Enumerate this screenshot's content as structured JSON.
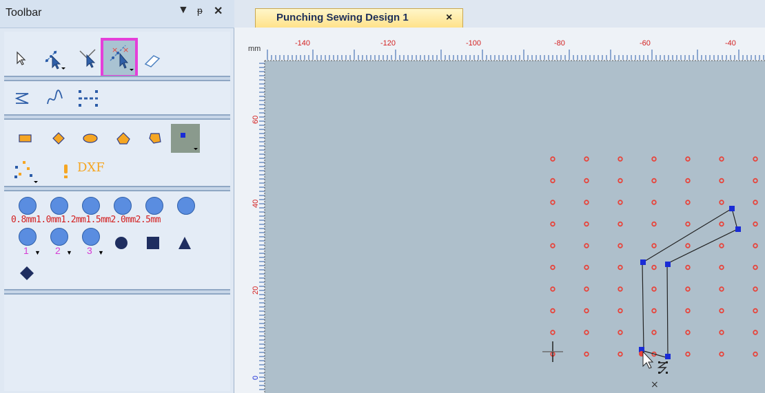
{
  "toolbar": {
    "title": "Toolbar",
    "dropdown_icon": "triangle-down",
    "pin_icon": "pin",
    "close_icon": "close",
    "dxf_label": "DXF",
    "mm_labels": "0.8mm1.0mm1.2mm1.5mm2.0mm2.5mm",
    "number_labels": [
      "1",
      "2",
      "3"
    ]
  },
  "document": {
    "tab_title": "Punching Sewing Design 1",
    "tab_close": "×",
    "ruler_unit": "mm",
    "top_ruler_labels": [
      "-140",
      "-120",
      "-100",
      "-80",
      "-60",
      "-40"
    ],
    "left_ruler_labels": [
      "60",
      "40",
      "20",
      "0"
    ]
  },
  "colors": {
    "highlight": "#e43fd9",
    "grid_dot": "#e8433a",
    "node": "#1a2cd6",
    "canvas_bg": "#aebfcb",
    "ruler_text": "#d32020"
  }
}
